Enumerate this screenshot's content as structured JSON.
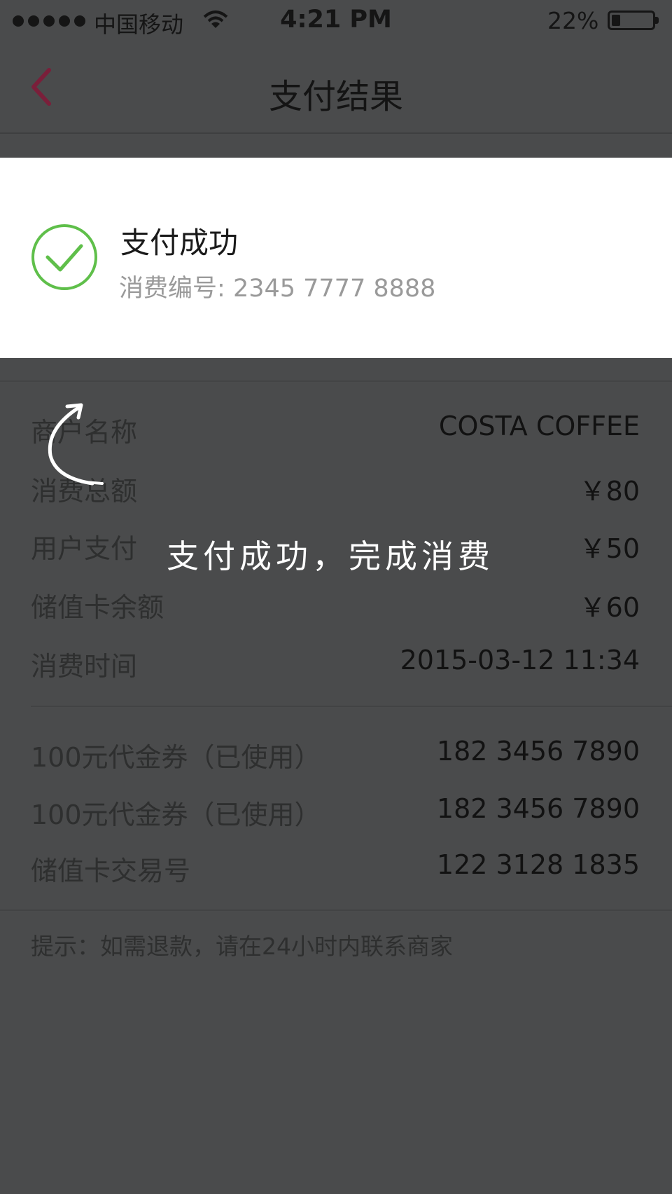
{
  "status_bar": {
    "carrier": "中国移动",
    "time": "4:21 PM",
    "battery_percent": "22%",
    "battery_level": 0.22,
    "signal_bars": 5
  },
  "nav": {
    "title": "支付结果",
    "back_icon": "chevron-left-icon",
    "accent_color": "#7a1f3a"
  },
  "result": {
    "title": "支付成功",
    "order_label": "消费编号:",
    "order_number": "2345 7777 8888",
    "icon": "check-circle-icon",
    "icon_color": "#5fbf4a"
  },
  "details": [
    {
      "label": "商户名称",
      "value": "COSTA COFFEE"
    },
    {
      "label": "消费总额",
      "value": "￥80"
    },
    {
      "label": "用户支付",
      "value": "￥50"
    },
    {
      "label": "储值卡余额",
      "value": "￥60"
    },
    {
      "label": "消费时间",
      "value": "2015-03-12 11:34"
    }
  ],
  "vouchers": [
    {
      "label": "100元代金券（已使用）",
      "value": "182 3456 7890"
    },
    {
      "label": "100元代金券（已使用）",
      "value": "182 3456 7890"
    },
    {
      "label": "储值卡交易号",
      "value": "122 3128 1835"
    }
  ],
  "tip": "提示：如需退款，请在24小时内联系商家",
  "overlay": {
    "annotation": "支付成功，完成消费",
    "arrow_icon": "curved-arrow-icon"
  }
}
